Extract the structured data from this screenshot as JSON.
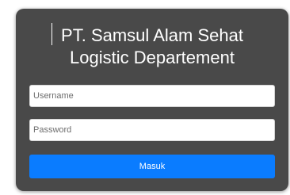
{
  "login": {
    "title_line1": "PT. Samsul Alam Sehat",
    "title_line2": "Logistic Departement",
    "username_placeholder": "Username",
    "username_value": "",
    "password_placeholder": "Password",
    "password_value": "",
    "submit_label": "Masuk"
  },
  "colors": {
    "card_background": "#494949",
    "button_background": "#0a7cff",
    "text_light": "#ffffff"
  }
}
